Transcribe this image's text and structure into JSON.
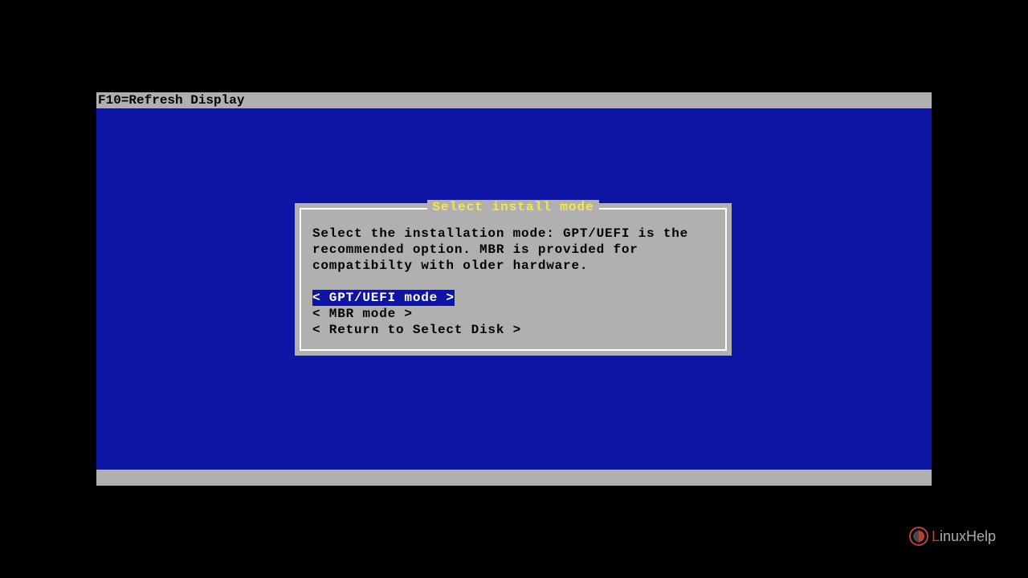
{
  "top_bar": {
    "hint": "F10=Refresh Display"
  },
  "dialog": {
    "title": "Select install mode",
    "body": "Select the installation mode: GPT/UEFI is the recommended option. MBR is provided for compatibilty with older hardware.",
    "options": [
      {
        "label": "GPT/UEFI mode",
        "selected": true
      },
      {
        "label": "MBR mode",
        "selected": false
      },
      {
        "label": "Return to Select Disk",
        "selected": false
      }
    ]
  },
  "logo": {
    "text_prefix": "L",
    "text_rest": "inuxHelp"
  }
}
